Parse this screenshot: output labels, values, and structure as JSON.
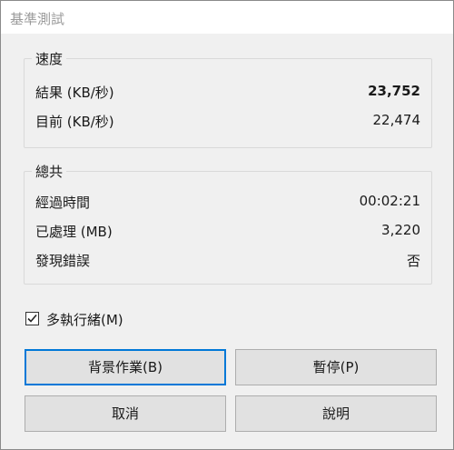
{
  "window": {
    "title": "基準測試"
  },
  "speed": {
    "label": "速度",
    "rows": [
      {
        "label": "結果 (KB/秒)",
        "value": "23,752"
      },
      {
        "label": "目前 (KB/秒)",
        "value": "22,474"
      }
    ]
  },
  "total": {
    "label": "總共",
    "rows": [
      {
        "label": "經過時間",
        "value": "00:02:21"
      },
      {
        "label": "已處理 (MB)",
        "value": "3,220"
      },
      {
        "label": "發現錯誤",
        "value": "否"
      }
    ]
  },
  "multithread": {
    "label": "多執行緒(M)",
    "checked": true
  },
  "buttons": {
    "background": "背景作業(B)",
    "pause": "暫停(P)",
    "cancel": "取消",
    "help": "說明"
  },
  "colors": {
    "accent": "#0078d7",
    "title_text": "#9a9a9a"
  }
}
